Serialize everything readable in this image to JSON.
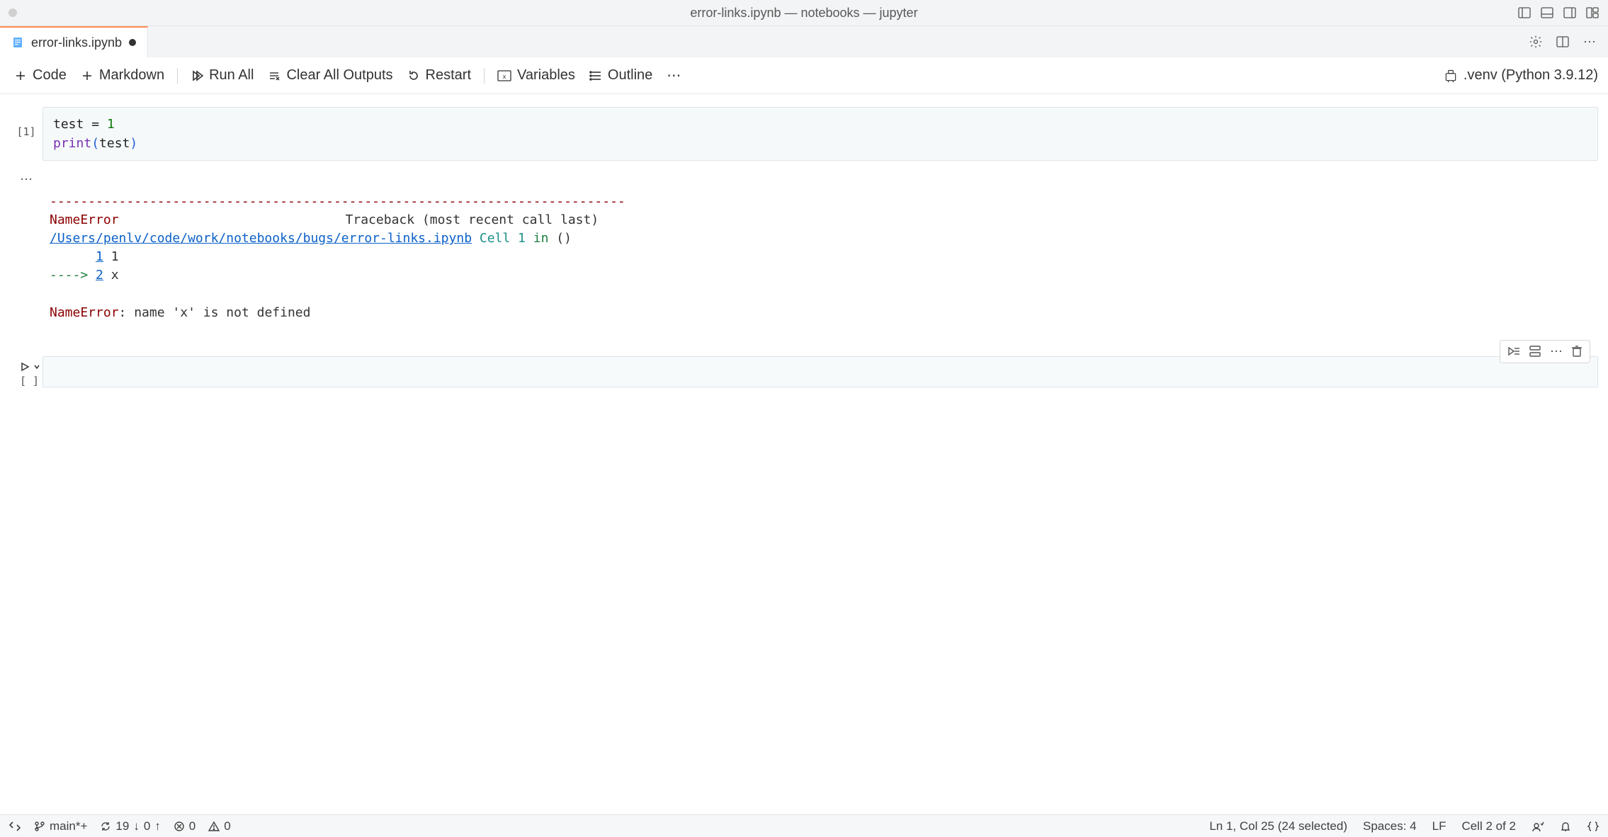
{
  "titlebar": {
    "title": "error-links.ipynb — notebooks — jupyter"
  },
  "tab": {
    "label": "error-links.ipynb"
  },
  "toolbar": {
    "code": "Code",
    "markdown": "Markdown",
    "runAll": "Run All",
    "clearOutputs": "Clear All Outputs",
    "restart": "Restart",
    "variables": "Variables",
    "outline": "Outline"
  },
  "kernel": {
    "label": ".venv (Python 3.9.12)"
  },
  "cell1": {
    "execCount": "[1]",
    "code": {
      "l1_id": "test",
      "l1_op": " = ",
      "l1_num": "1",
      "l2_func": "print",
      "l2_arg": "test"
    },
    "output": {
      "hr": "---------------------------------------------------------------------------",
      "errName": "NameError",
      "traceback": "Traceback (most recent call last)",
      "path": "/Users/penlv/code/work/notebooks/bugs/error-links.ipynb",
      "cellLabel": " Cell 1",
      "inLabel": " in ",
      "parens": "()",
      "arrow": "----> ",
      "line1no": "1",
      "line1txt": " 1",
      "line2no": "2",
      "line2txt": " x",
      "errFinalName": "NameError",
      "errFinalMsg": ": name 'x' is not defined"
    }
  },
  "cell2": {
    "execCount": "[ ]"
  },
  "status": {
    "branch": "main*+",
    "syncDown": "19",
    "syncUp": "0",
    "errors": "0",
    "warnings": "0",
    "cursor": "Ln 1, Col 25 (24 selected)",
    "spaces": "Spaces: 4",
    "eol": "LF",
    "cell": "Cell 2 of 2"
  }
}
